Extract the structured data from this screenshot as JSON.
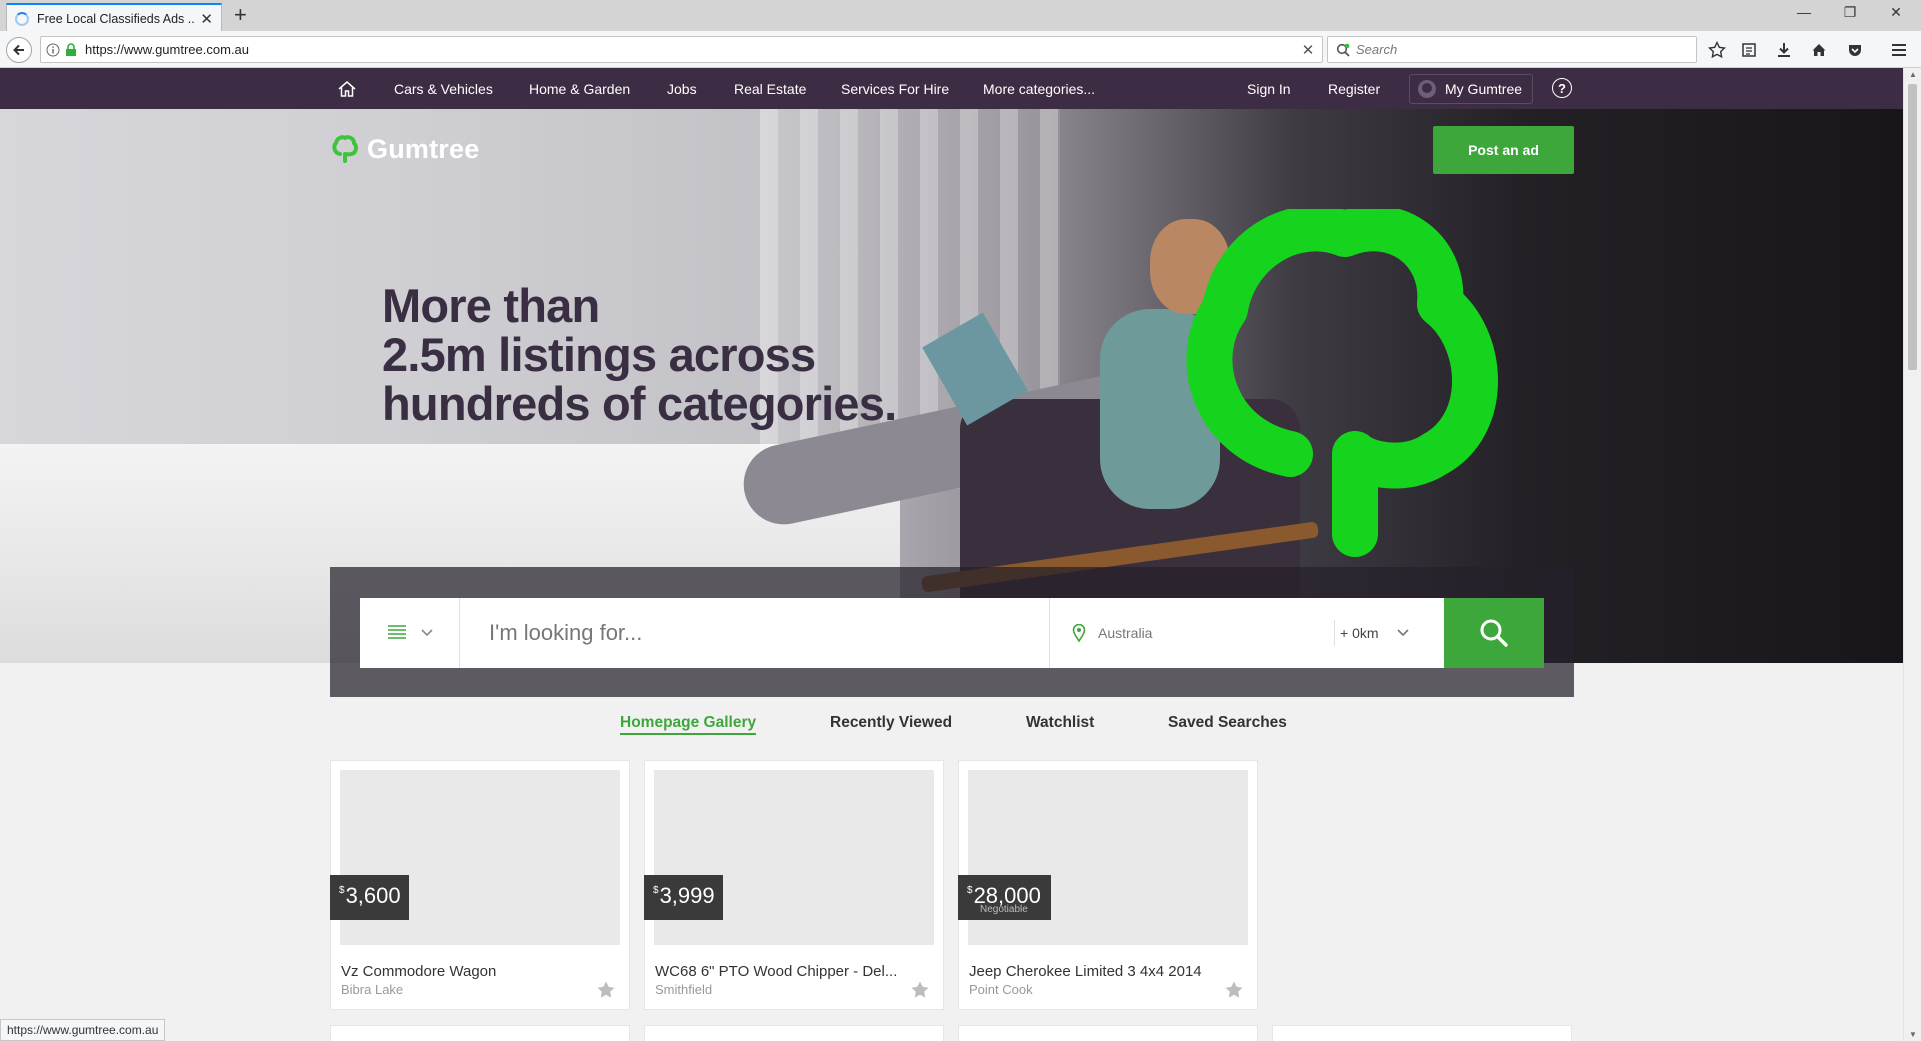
{
  "browser": {
    "tab_title": "Free Local Classifieds Ads ...",
    "url": "https://www.gumtree.com.au",
    "search_placeholder": "Search",
    "status_url": "https://www.gumtree.com.au"
  },
  "sitenav": {
    "categories": [
      "Cars & Vehicles",
      "Home & Garden",
      "Jobs",
      "Real Estate",
      "Services For Hire",
      "More categories..."
    ],
    "sign_in": "Sign In",
    "register": "Register",
    "my_gumtree": "My Gumtree",
    "help": "?"
  },
  "hero": {
    "brand": "Gumtree",
    "post_ad": "Post an ad",
    "headline": [
      "More than",
      "2.5m listings across",
      "hundreds of categories."
    ]
  },
  "search": {
    "query_placeholder": "I'm looking for...",
    "location": "Australia",
    "radius": "+ 0km"
  },
  "gallery_tabs": [
    {
      "label": "Homepage Gallery",
      "active": true
    },
    {
      "label": "Recently Viewed",
      "active": false
    },
    {
      "label": "Watchlist",
      "active": false
    },
    {
      "label": "Saved Searches",
      "active": false
    }
  ],
  "listings": [
    {
      "currency": "$",
      "price": "3,600",
      "note": "",
      "title": "Vz Commodore Wagon",
      "location": "Bibra Lake"
    },
    {
      "currency": "$",
      "price": "3,999",
      "note": "",
      "title": "WC68 6\" PTO Wood Chipper - Del...",
      "location": "Smithfield"
    },
    {
      "currency": "$",
      "price": "28,000",
      "note": "Negotiable",
      "title": "Jeep Cherokee Limited 3 4x4 2014",
      "location": "Point Cook"
    }
  ],
  "colors": {
    "nav_bg": "#3c2d44",
    "brand_green": "#3ea73b",
    "logo_green": "#16d41d",
    "headline": "#3a2e43"
  },
  "icons": [
    "home-icon",
    "search-icon",
    "location-pin-icon",
    "list-icon",
    "chevron-down-icon",
    "star-icon",
    "user-icon",
    "help-icon"
  ]
}
